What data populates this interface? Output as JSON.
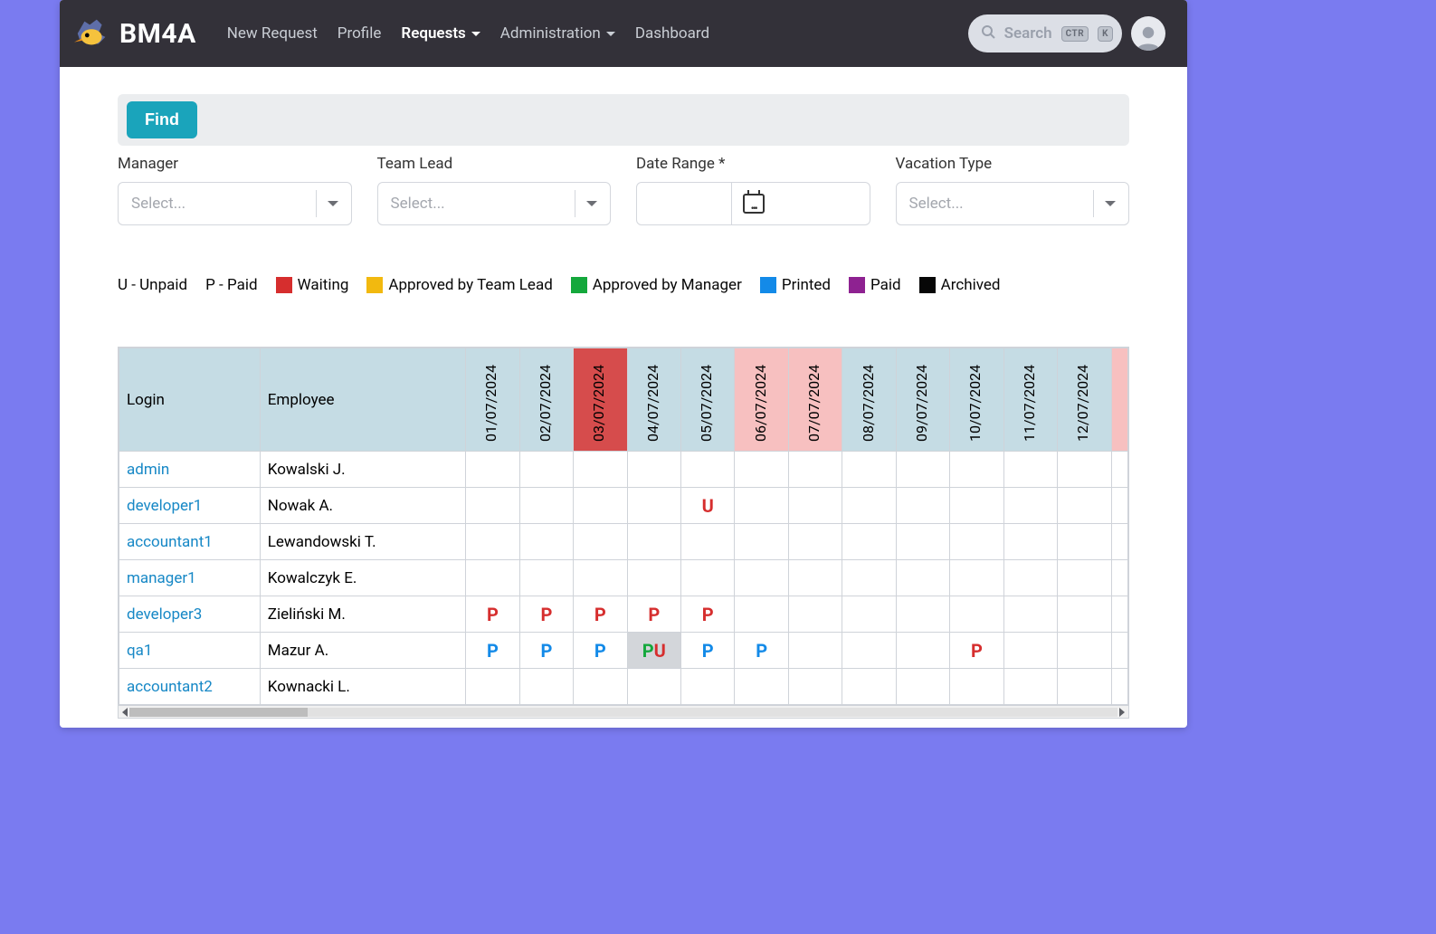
{
  "header": {
    "app_name": "BM4A",
    "nav": [
      {
        "label": "New Request",
        "active": false,
        "has_chevron": false
      },
      {
        "label": "Profile",
        "active": false,
        "has_chevron": false
      },
      {
        "label": "Requests",
        "active": true,
        "has_chevron": true
      },
      {
        "label": "Administration",
        "active": false,
        "has_chevron": true
      },
      {
        "label": "Dashboard",
        "active": false,
        "has_chevron": false
      }
    ],
    "search_placeholder": "Search",
    "kbd1": "CTR",
    "kbd2": "K"
  },
  "findbar": {
    "find_label": "Find"
  },
  "filters": {
    "manager_label": "Manager",
    "manager_placeholder": "Select...",
    "teamlead_label": "Team Lead",
    "teamlead_placeholder": "Select...",
    "daterange_label": "Date Range *",
    "vactype_label": "Vacation Type",
    "vactype_placeholder": "Select..."
  },
  "legend": {
    "u_unpaid": "U - Unpaid",
    "p_paid": "P - Paid",
    "waiting": "Waiting",
    "approved_tl": "Approved by Team Lead",
    "approved_mgr": "Approved by Manager",
    "printed": "Printed",
    "paid": "Paid",
    "archived": "Archived"
  },
  "table": {
    "header_login": "Login",
    "header_employee": "Employee",
    "dates": [
      {
        "label": "01/07/2024",
        "class": ""
      },
      {
        "label": "02/07/2024",
        "class": ""
      },
      {
        "label": "03/07/2024",
        "class": "today"
      },
      {
        "label": "04/07/2024",
        "class": ""
      },
      {
        "label": "05/07/2024",
        "class": ""
      },
      {
        "label": "06/07/2024",
        "class": "wknd"
      },
      {
        "label": "07/07/2024",
        "class": "wknd"
      },
      {
        "label": "08/07/2024",
        "class": ""
      },
      {
        "label": "09/07/2024",
        "class": ""
      },
      {
        "label": "10/07/2024",
        "class": ""
      },
      {
        "label": "11/07/2024",
        "class": ""
      },
      {
        "label": "12/07/2024",
        "class": ""
      }
    ],
    "rows": [
      {
        "login": "admin",
        "employee": "Kowalski J.",
        "cells": [
          "",
          "",
          "",
          "",
          "",
          "",
          "",
          "",
          "",
          "",
          "",
          ""
        ]
      },
      {
        "login": "developer1",
        "employee": "Nowak A.",
        "cells": [
          "",
          "",
          "",
          "",
          "U-wait",
          "",
          "",
          "",
          "",
          "",
          "",
          ""
        ]
      },
      {
        "login": "accountant1",
        "employee": "Lewandowski T.",
        "cells": [
          "",
          "",
          "",
          "",
          "",
          "",
          "",
          "",
          "",
          "",
          "",
          ""
        ]
      },
      {
        "login": "manager1",
        "employee": "Kowalczyk E.",
        "cells": [
          "",
          "",
          "",
          "",
          "",
          "",
          "",
          "",
          "",
          "",
          "",
          ""
        ]
      },
      {
        "login": "developer3",
        "employee": "Zieliński M.",
        "cells": [
          "P-wait",
          "P-wait",
          "P-wait",
          "P-wait",
          "P-wait",
          "",
          "",
          "",
          "",
          "",
          "",
          ""
        ]
      },
      {
        "login": "qa1",
        "employee": "Mazur A.",
        "cells": [
          "P-print",
          "P-print",
          "P-print",
          "PU",
          "P-print",
          "P-print",
          "",
          "",
          "",
          "P-wait",
          "",
          ""
        ]
      },
      {
        "login": "accountant2",
        "employee": "Kownacki L.",
        "cells": [
          "",
          "",
          "",
          "",
          "",
          "",
          "",
          "",
          "",
          "",
          "",
          ""
        ]
      }
    ]
  }
}
